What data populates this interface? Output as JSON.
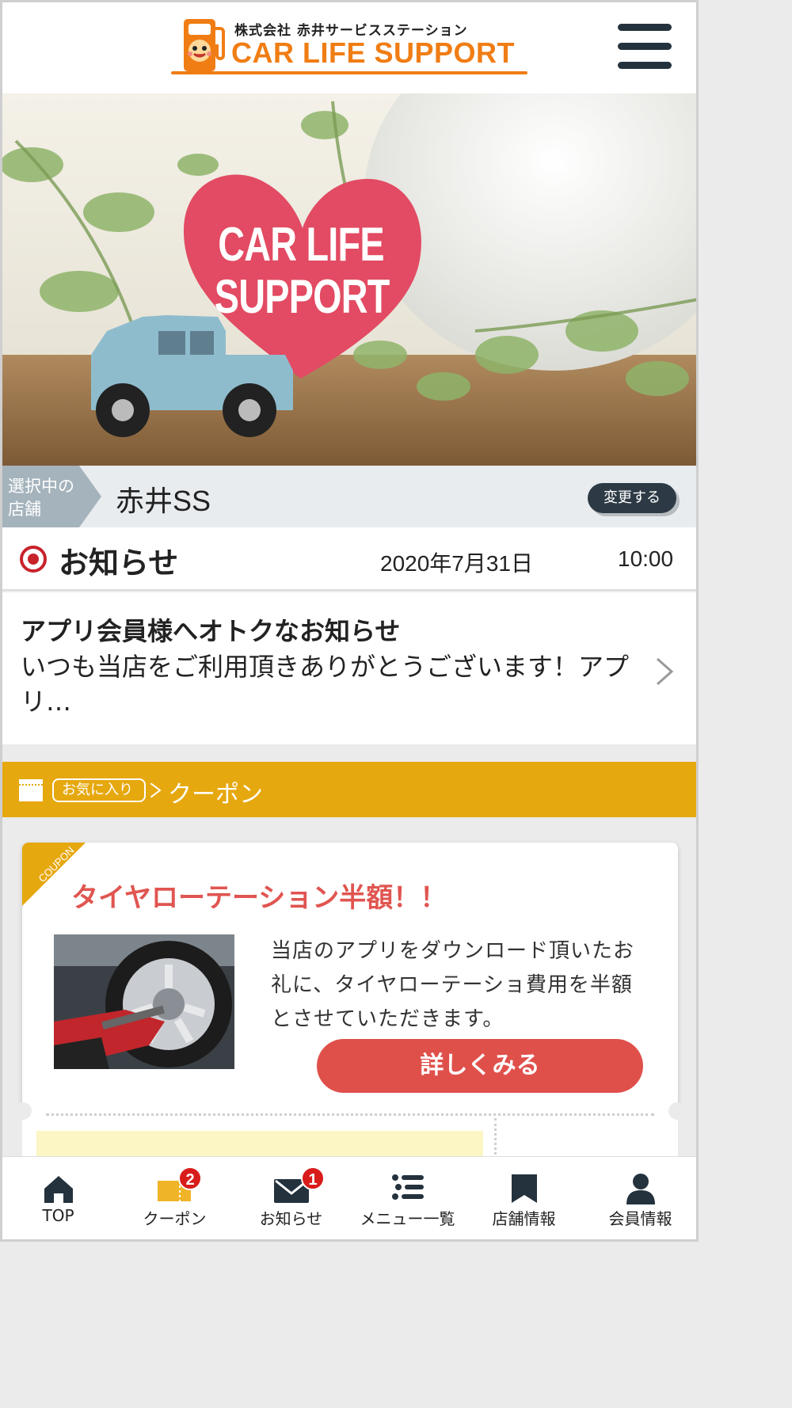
{
  "header": {
    "company_name": "株式会社 赤井サービスステーション",
    "brand": "CAR LIFE SUPPORT",
    "menu_icon": "hamburger-menu-icon",
    "accent_color": "#f07d14"
  },
  "hero": {
    "heart_text_line1": "CAR LIFE",
    "heart_text_line2": "SUPPORT"
  },
  "store": {
    "tag_line1": "選択中の",
    "tag_line2": "店舗",
    "name": "赤井SS",
    "change_button": "変更する"
  },
  "notice": {
    "title": "お知らせ",
    "date": "2020年7月31日",
    "time": "10:00",
    "item_title": "アプリ会員様へオトクなお知らせ",
    "item_body": "いつも当店をご利用頂きありがとうございます！アプリ…"
  },
  "coupon_section": {
    "favorite_tag": "お気に入り",
    "label": "クーポン",
    "band_color": "#e6a80f"
  },
  "coupon": {
    "corner_label": "COUPON",
    "title": "タイヤローテーション半額！！",
    "description": "当店のアプリをダウンロード頂いたお礼に、タイヤローテーショ費用を半額とさせていただきます。",
    "detail_button": "詳しくみる",
    "button_color": "#e0504b"
  },
  "bottom_nav": {
    "items": [
      {
        "label": "TOP",
        "icon": "home-icon"
      },
      {
        "label": "クーポン",
        "icon": "coupon-icon",
        "badge": "2"
      },
      {
        "label": "お知らせ",
        "icon": "mail-icon",
        "badge": "1"
      },
      {
        "label": "メニュー一覧",
        "icon": "list-icon"
      },
      {
        "label": "店舗情報",
        "icon": "store-icon"
      },
      {
        "label": "会員情報",
        "icon": "person-icon"
      }
    ]
  }
}
